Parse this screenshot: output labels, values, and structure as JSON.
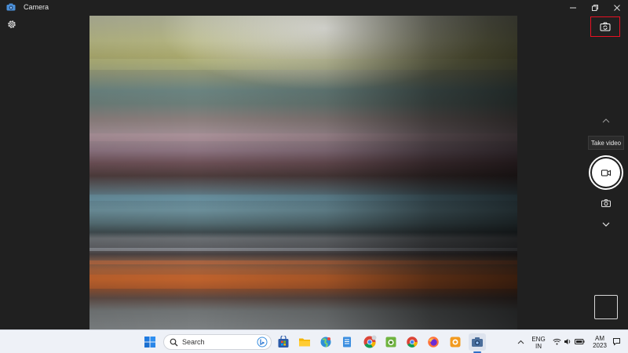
{
  "window": {
    "title": "Camera",
    "controls": [
      "minimize",
      "restore",
      "close"
    ]
  },
  "camera": {
    "tooltip": "Take video",
    "mode": "video"
  },
  "taskbar": {
    "search_placeholder": "Search",
    "apps": [
      "start",
      "search",
      "store",
      "file-explorer",
      "earth-app",
      "notepad",
      "chrome",
      "green-app",
      "chrome",
      "firefox",
      "orange-app",
      "camera"
    ],
    "language_top": "ENG",
    "language_bottom": "IN",
    "clock_top": "AM",
    "clock_bottom": "2023"
  },
  "colors": {
    "app_background": "#202020",
    "highlight": "#e81123",
    "taskbar": "#eef1f7"
  }
}
